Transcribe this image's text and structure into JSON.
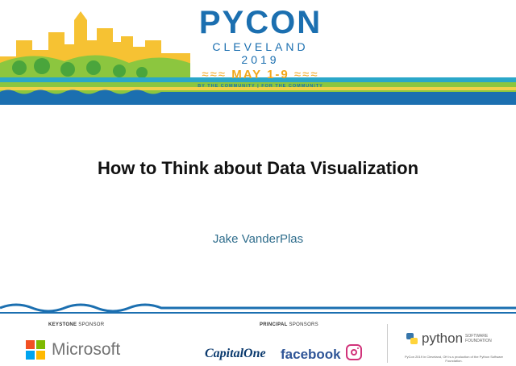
{
  "header": {
    "logo_title": "PYCON",
    "logo_city": "CLEVELAND 2019",
    "logo_dates": "MAY 1-9",
    "logo_tagline": "BY THE COMMUNITY | FOR THE COMMUNITY"
  },
  "slide": {
    "title": "How to Think about Data Visualization",
    "author": "Jake VanderPlas"
  },
  "sponsors": {
    "keystone_label_bold": "KEYSTONE",
    "keystone_label_rest": " SPONSOR",
    "principal_label_bold": "PRINCIPAL",
    "principal_label_rest": " SPONSORS",
    "microsoft": "Microsoft",
    "capitalone": "CapitalOne",
    "facebook": "facebook",
    "psf_word": "python",
    "psf_sub1": "SOFTWARE",
    "psf_sub2": "FOUNDATION",
    "psf_note": "PyCon 2019 in Cleveland, OH is a production of the Python Software Foundation."
  },
  "colors": {
    "brand_blue": "#1b6fb0",
    "brand_yellow": "#f2a71b",
    "brand_green": "#8cc63f",
    "brand_teal": "#2aa7c9"
  }
}
